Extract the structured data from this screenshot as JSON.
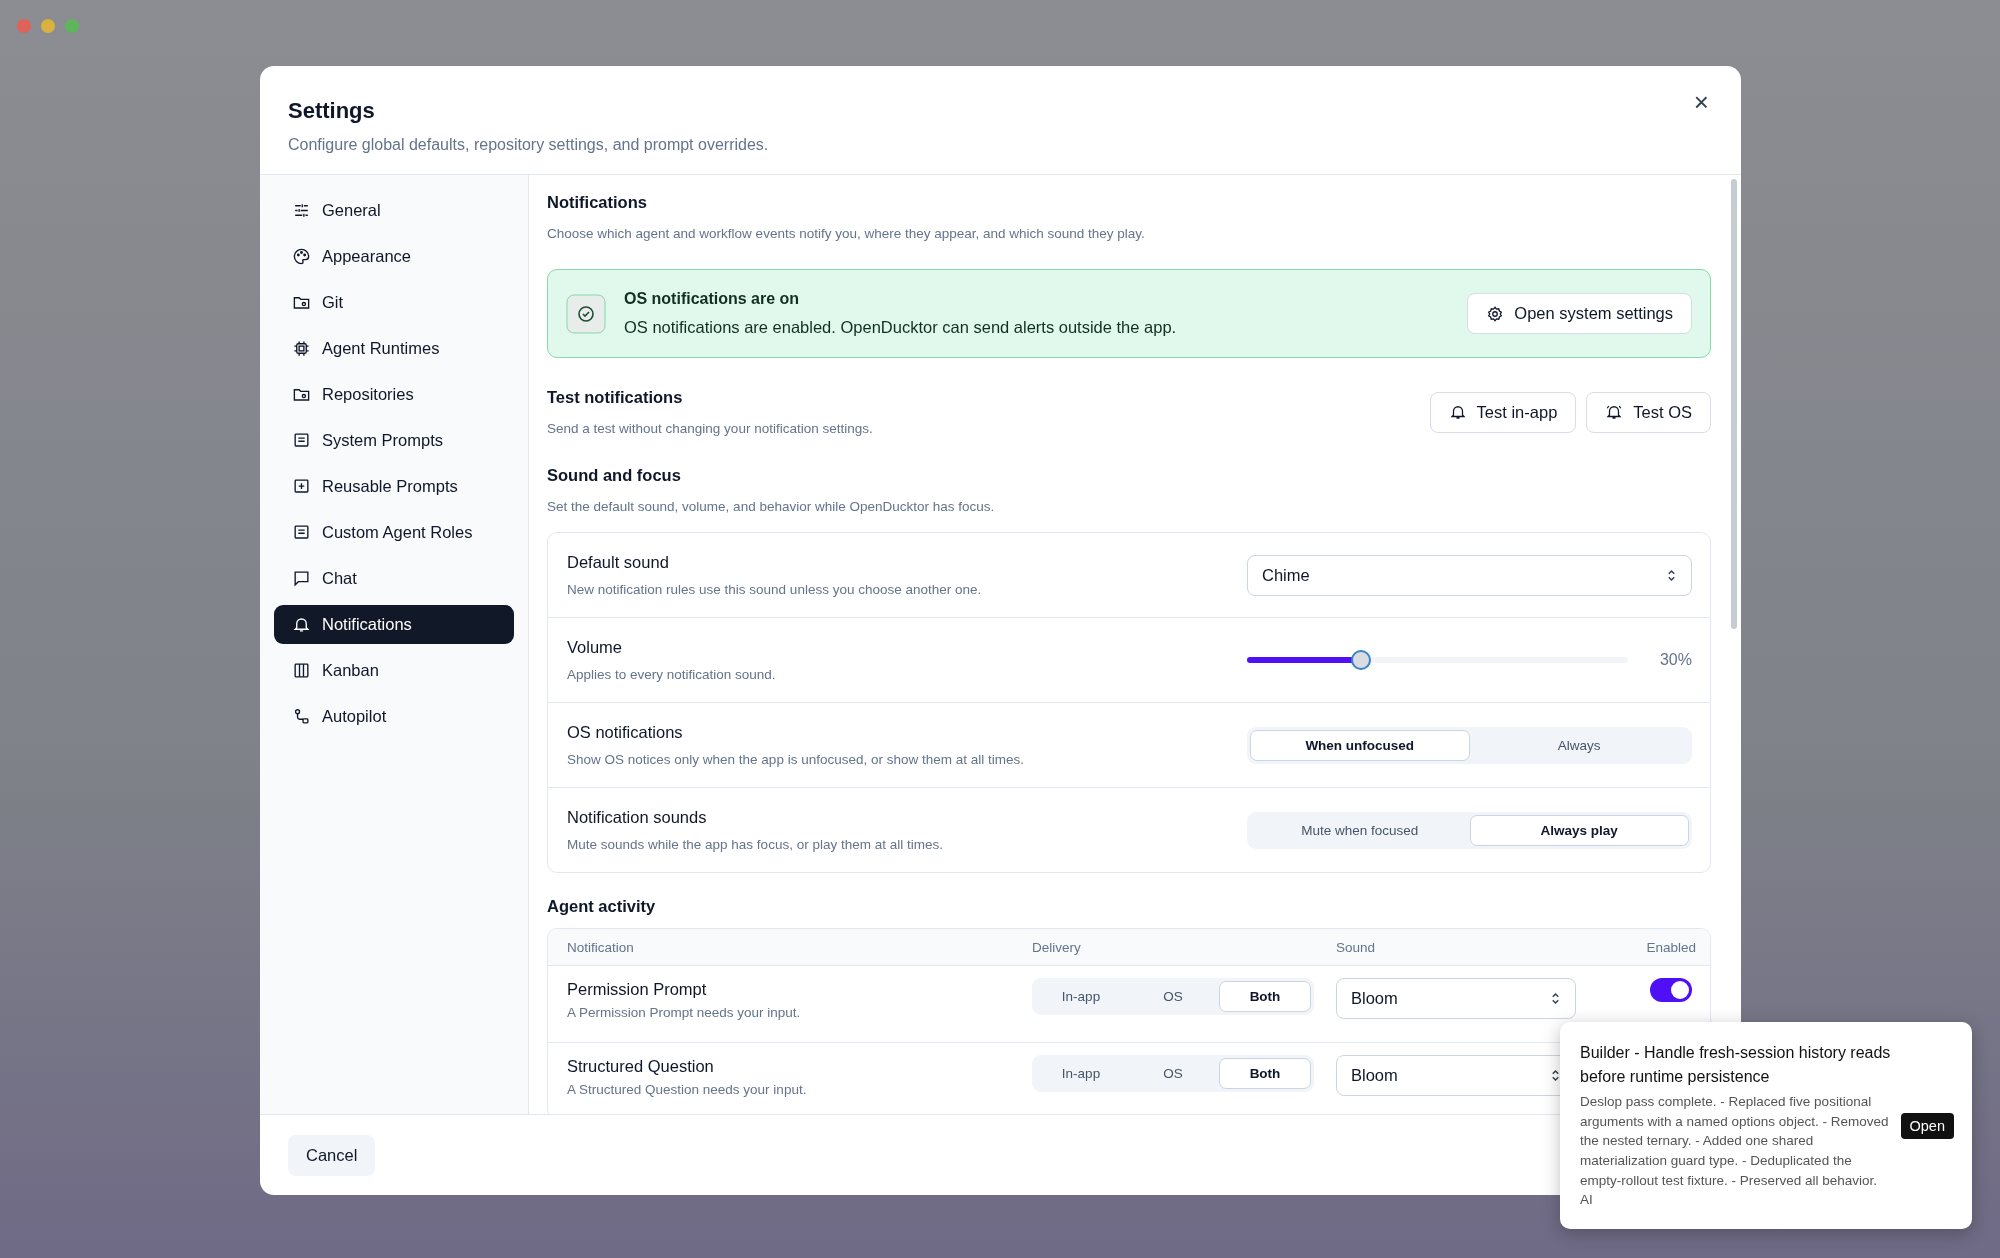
{
  "dialog": {
    "title": "Settings",
    "subtitle": "Configure global defaults, repository settings, and prompt overrides.",
    "close": "×"
  },
  "sidebar": {
    "items": [
      {
        "label": "General",
        "selected": false
      },
      {
        "label": "Appearance",
        "selected": false
      },
      {
        "label": "Git",
        "selected": false
      },
      {
        "label": "Agent Runtimes",
        "selected": false
      },
      {
        "label": "Repositories",
        "selected": false
      },
      {
        "label": "System Prompts",
        "selected": false
      },
      {
        "label": "Reusable Prompts",
        "selected": false
      },
      {
        "label": "Custom Agent Roles",
        "selected": false
      },
      {
        "label": "Chat",
        "selected": false
      },
      {
        "label": "Notifications",
        "selected": true
      },
      {
        "label": "Kanban",
        "selected": false
      },
      {
        "label": "Autopilot",
        "selected": false
      }
    ]
  },
  "section": {
    "title": "Notifications",
    "description": "Choose which agent and workflow events notify you, where they appear, and which sound they play."
  },
  "banner": {
    "title": "OS notifications are on",
    "message": "OS notifications are enabled. OpenDucktor can send alerts outside the app.",
    "button": "Open system settings"
  },
  "test": {
    "title": "Test notifications",
    "description": "Send a test without changing your notification settings.",
    "buttons": [
      "Test in-app",
      "Test OS"
    ]
  },
  "sound_focus": {
    "title": "Sound and focus",
    "description": "Set the default sound, volume, and behavior while OpenDucktor has focus.",
    "rows": [
      {
        "kind": "select",
        "title": "Default sound",
        "description": "New notification rules use this sound unless you choose another one.",
        "value": "Chime"
      },
      {
        "kind": "slider",
        "title": "Volume",
        "description": "Applies to every notification sound.",
        "level": 0.3,
        "reading": "30%"
      },
      {
        "kind": "segmented",
        "title": "OS notifications",
        "description": "Show OS notices only when the app is unfocused, or show them at all times.",
        "options": [
          {
            "label": "When unfocused",
            "selected": true
          },
          {
            "label": "Always",
            "selected": false
          }
        ]
      },
      {
        "kind": "segmented",
        "title": "Notification sounds",
        "description": "Mute sounds while the app has focus, or play them at all times.",
        "options": [
          {
            "label": "Mute when focused",
            "selected": false
          },
          {
            "label": "Always play",
            "selected": true
          }
        ]
      }
    ]
  },
  "agent_activity": {
    "title": "Agent activity",
    "columns": [
      "Notification",
      "Delivery",
      "Sound",
      "Enabled"
    ],
    "rows": [
      {
        "name": "Permission Prompt",
        "description": "A Permission Prompt needs your input.",
        "delivery": [
          {
            "label": "In-app",
            "selected": false
          },
          {
            "label": "OS",
            "selected": false
          },
          {
            "label": "Both",
            "selected": true
          }
        ],
        "sound": "Bloom",
        "enabled": true
      },
      {
        "name": "Structured Question",
        "description": "A Structured Question needs your input.",
        "delivery": [
          {
            "label": "In-app",
            "selected": false
          },
          {
            "label": "OS",
            "selected": false
          },
          {
            "label": "Both",
            "selected": true
          }
        ],
        "sound": "Bloom"
      }
    ]
  },
  "footer": {
    "cancel": "Cancel"
  },
  "toast": {
    "title": "Builder - Handle fresh-session history reads before runtime persistence",
    "body": "Deslop pass complete. - Replaced five positional arguments with a named options object. - Removed the nested ternary. - Added one shared materialization guard type. - Deduplicated the empty-rollout test fixture. - Preserved all behavior. AI",
    "action": "Open"
  }
}
